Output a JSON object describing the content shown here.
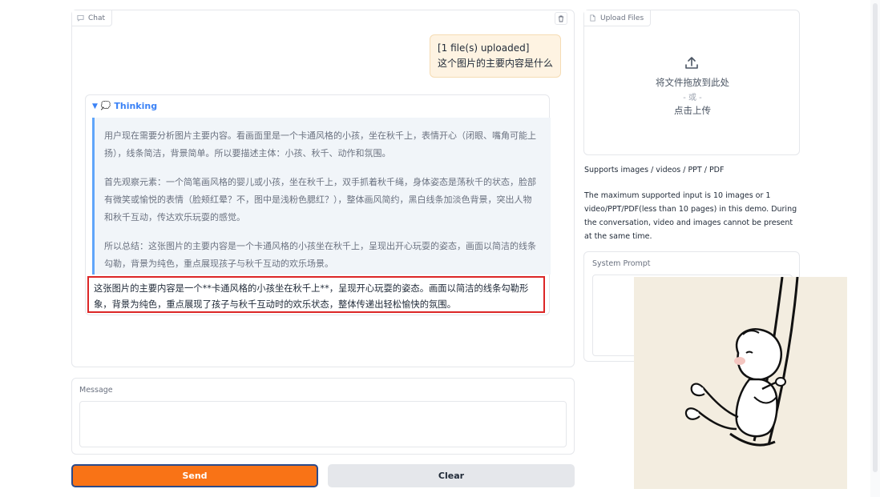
{
  "chat": {
    "tab_label": "Chat",
    "user_message": {
      "line1": "[1 file(s) uploaded]",
      "line2": "这个图片的主要内容是什么"
    },
    "thinking": {
      "title": "Thinking",
      "paragraphs": [
        "用户现在需要分析图片主要内容。看画面里是一个卡通风格的小孩，坐在秋千上，表情开心（闭眼、嘴角可能上扬），线条简洁，背景简单。所以要描述主体：小孩、秋千、动作和氛围。",
        "首先观察元素：一个简笔画风格的婴儿或小孩，坐在秋千上，双手抓着秋千绳，身体姿态是荡秋千的状态，脸部有微笑或愉悦的表情（脸颊红晕？不，图中是浅粉色腮红？），整体画风简约，黑白线条加淡色背景，突出人物和秋千互动，传达欢乐玩耍的感觉。",
        "所以总结：这张图片的主要内容是一个卡通风格的小孩坐在秋千上，呈现出开心玩耍的姿态，画面以简洁的线条勾勒，背景为纯色，重点展现孩子与秋千互动的欢乐场景。"
      ]
    },
    "answer": "这张图片的主要内容是一个**卡通风格的小孩坐在秋千上**，呈现开心玩耍的姿态。画面以简洁的线条勾勒形象，背景为纯色，重点展现了孩子与秋千互动时的欢乐状态，整体传递出轻松愉快的氛围。"
  },
  "message": {
    "label": "Message",
    "value": "",
    "placeholder": ""
  },
  "buttons": {
    "send": "Send",
    "clear": "Clear"
  },
  "upload": {
    "tab_label": "Upload Files",
    "drop_text": "将文件拖放到此处",
    "or_text": "- 或 -",
    "click_text": "点击上传"
  },
  "supports_text": "Supports images / videos / PPT / PDF",
  "info_text": "The maximum supported input is 10 images or 1 video/PPT/PDF(less than 10 pages) in this demo. During the conversation, video and images cannot be present at the same time.",
  "system_prompt": {
    "label": "System Prompt",
    "value": ""
  },
  "colors": {
    "accent": "#f97316",
    "thinking_blue": "#3b82f6",
    "highlight_border": "#dc2626",
    "user_bubble": "#fef3e2",
    "illustration_bg": "#f3ede0"
  }
}
